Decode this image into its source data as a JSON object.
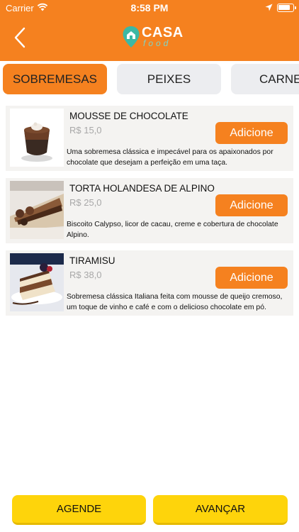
{
  "status_bar": {
    "carrier": "Carrier",
    "time": "8:58 PM"
  },
  "header": {
    "brand_main": "CASA",
    "brand_sub": "food",
    "back_icon": "chevron-left-icon",
    "accent_color": "#f5811f"
  },
  "tabs": [
    {
      "label": "SOBREMESAS",
      "active": true
    },
    {
      "label": "PEIXES",
      "active": false
    },
    {
      "label": "CARNE",
      "active": false
    }
  ],
  "products": [
    {
      "name": "MOUSSE DE CHOCOLATE",
      "price": "R$ 15,0",
      "button": "Adicione",
      "description": "Uma sobremesa clássica e impecável para os apaixonados por chocolate que desejam a perfeição em uma taça."
    },
    {
      "name": "TORTA HOLANDESA DE ALPINO",
      "price": "R$ 25,0",
      "button": "Adicione",
      "description": "Biscoito Calypso, licor de cacau, creme e cobertura de chocolate Alpino."
    },
    {
      "name": "TIRAMISU",
      "price": "R$ 38,0",
      "button": "Adicione",
      "description": "Sobremesa clássica Italiana feita com mousse de queijo cremoso, um toque de vinho e café e com o delicioso chocolate em pó."
    }
  ],
  "footer": {
    "schedule_label": "AGENDE",
    "next_label": "AVANÇAR",
    "button_color": "#fed40b"
  }
}
